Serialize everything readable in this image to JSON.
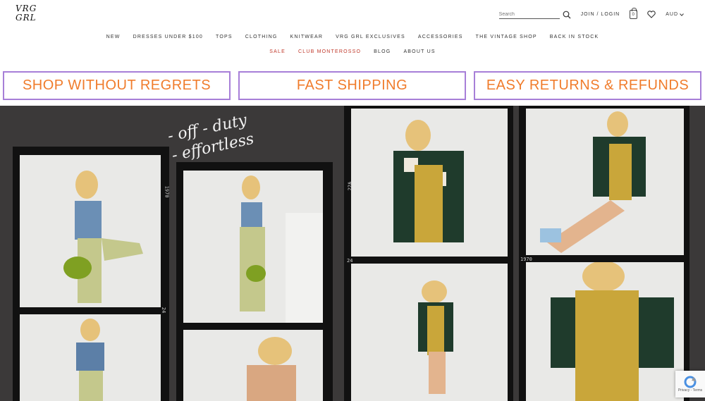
{
  "brand": {
    "logo_line1": "VRG",
    "logo_line2": "GRL"
  },
  "header": {
    "search_placeholder": "Search",
    "account_label": "JOIN / LOGIN",
    "cart_count": "0",
    "currency": "AUD",
    "icons": [
      "search-icon",
      "cart-icon",
      "heart-icon",
      "chevron-down-icon"
    ]
  },
  "nav": {
    "primary": [
      "NEW",
      "DRESSES UNDER $100",
      "TOPS",
      "CLOTHING",
      "KNITWEAR",
      "VRG GRL EXCLUSIVES",
      "ACCESSORIES",
      "THE VINTAGE SHOP",
      "BACK IN STOCK"
    ],
    "secondary": [
      "SALE",
      "CLUB MONTEROSSO",
      "BLOG",
      "ABOUT US"
    ]
  },
  "promos": [
    "SHOP WITHOUT REGRETS",
    "FAST SHIPPING",
    "EASY RETURNS & REFUNDS"
  ],
  "colors": {
    "promo_text": "#f07c2c",
    "promo_border": "#a77fd8",
    "sale_red": "#c0392b",
    "hero_bg": "#3b3939"
  },
  "hero": {
    "tagline_line1": "- off - duty",
    "tagline_line2": "- effortless",
    "film_labels": [
      "1970",
      "24",
      "22A",
      "24",
      "1970"
    ]
  },
  "recaptcha": {
    "label": "Privacy - Terms"
  }
}
